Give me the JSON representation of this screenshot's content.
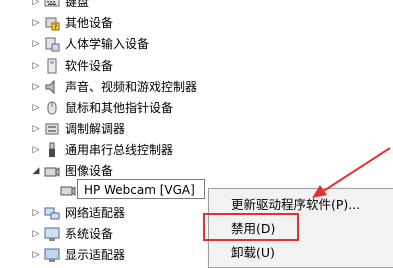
{
  "device_manager": {
    "categories": [
      {
        "label": "键盘",
        "icon": "keyboard-icon"
      },
      {
        "label": "其他设备",
        "icon": "unknown-device-icon"
      },
      {
        "label": "人体学输入设备",
        "icon": "hid-icon"
      },
      {
        "label": "软件设备",
        "icon": "software-device-icon"
      },
      {
        "label": "声音、视频和游戏控制器",
        "icon": "speaker-icon"
      },
      {
        "label": "鼠标和其他指针设备",
        "icon": "mouse-icon"
      },
      {
        "label": "调制解调器",
        "icon": "modem-icon"
      },
      {
        "label": "通用串行总线控制器",
        "icon": "usb-icon"
      },
      {
        "label": "图像设备",
        "icon": "camera-icon",
        "expanded": true
      },
      {
        "label": "网络适配器",
        "icon": "network-adapter-icon"
      },
      {
        "label": "系统设备",
        "icon": "system-device-icon"
      },
      {
        "label": "显示适配器",
        "icon": "display-adapter-icon"
      }
    ],
    "child_device": {
      "label": "HP Webcam [VGA]",
      "icon": "webcam-icon"
    }
  },
  "context_menu": {
    "items": [
      {
        "label": "更新驱动程序软件(P)..."
      },
      {
        "label": "禁用(D)",
        "highlighted": true
      },
      {
        "label": "卸载(U)"
      }
    ]
  },
  "annotation": {
    "highlight_color": "#e33030",
    "arrow_color": "#e33030"
  }
}
